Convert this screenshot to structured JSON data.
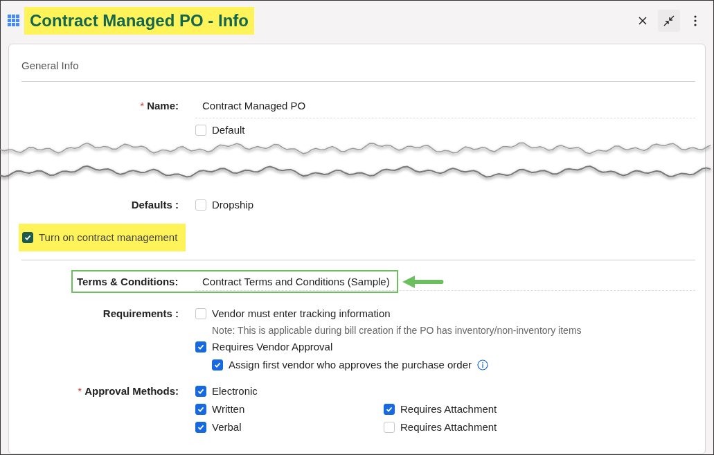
{
  "header": {
    "title": "Contract Managed PO - Info"
  },
  "card": {
    "title": "General Info"
  },
  "name_field": {
    "required_mark": "*",
    "label": "Name:",
    "value": "Contract Managed PO"
  },
  "options": [
    {
      "label": "Default",
      "checked": false
    }
  ],
  "defaults": {
    "label": "Defaults :",
    "options": [
      {
        "label": "Dropship",
        "checked": false
      }
    ]
  },
  "contract_management": {
    "label": "Turn on contract management",
    "checked": true
  },
  "terms": {
    "label": "Terms & Conditions:",
    "value": "Contract Terms and Conditions (Sample)"
  },
  "requirements": {
    "label": "Requirements :",
    "items": [
      {
        "label": "Vendor must enter tracking information",
        "checked": false,
        "note": "Note: This is applicable during bill creation if the PO has inventory/non-inventory items"
      },
      {
        "label": "Requires Vendor Approval",
        "checked": true,
        "children": [
          {
            "label": "Assign first vendor who approves the purchase order",
            "checked": true,
            "info": true
          }
        ]
      }
    ]
  },
  "approval": {
    "required_mark": "*",
    "label": "Approval Methods:",
    "methods": [
      {
        "label": "Electronic",
        "checked": true
      },
      {
        "label": "Written",
        "checked": true,
        "attachment": {
          "label": "Requires Attachment",
          "checked": true
        }
      },
      {
        "label": "Verbal",
        "checked": true,
        "attachment": {
          "label": "Requires Attachment",
          "checked": false
        }
      }
    ]
  }
}
